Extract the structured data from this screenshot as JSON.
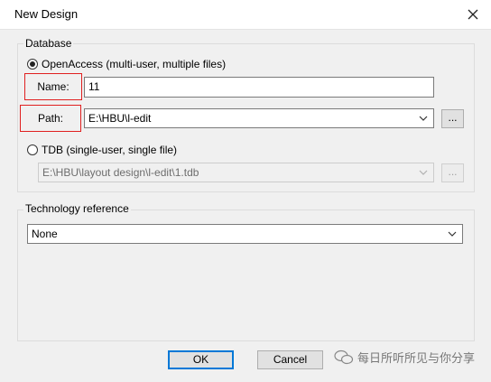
{
  "window": {
    "title": "New Design"
  },
  "database": {
    "label": "Database",
    "openaccess_label": "OpenAccess (multi-user, multiple files)",
    "name_label": "Name:",
    "name_value": "11",
    "path_label": "Path:",
    "path_value": "E:\\HBU\\l-edit",
    "browse_label": "...",
    "tdb_label": "TDB (single-user, single file)",
    "tdb_path_value": "E:\\HBU\\layout design\\l-edit\\1.tdb",
    "tdb_browse_label": "..."
  },
  "technology": {
    "label": "Technology reference",
    "selected": "None"
  },
  "buttons": {
    "ok": "OK",
    "cancel": "Cancel"
  },
  "watermark": {
    "text": "每日所听所见与你分享"
  }
}
